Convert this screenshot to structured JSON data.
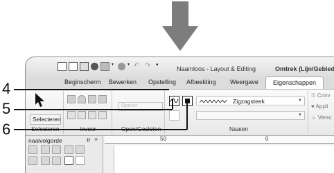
{
  "window": {
    "title": "Naamloos - Layout & Editing",
    "context_title": "Omtrek (Lijn/Gebied)"
  },
  "tabs": [
    {
      "label": "Beginscherm"
    },
    {
      "label": "Bewerken"
    },
    {
      "label": "Opstelling"
    },
    {
      "label": "Afbeelding"
    },
    {
      "label": "Weergave"
    },
    {
      "label": "Eigenschappen"
    }
  ],
  "ribbon": {
    "select_button": "Selecteren",
    "groups": [
      "Selecteren",
      "Invoer",
      "Open/Gesloten",
      "Naaien"
    ],
    "stitch_combo_value": "Zigzagsteek",
    "faded_combo_value": "Opener",
    "side_items": [
      "Conv",
      "Appli",
      "Versc"
    ]
  },
  "panel": {
    "title": "naaivolgorde",
    "pin": "⭿",
    "close": "×"
  },
  "ruler": {
    "labels": [
      "50",
      "0"
    ]
  },
  "callouts": [
    "4",
    "5",
    "6"
  ]
}
